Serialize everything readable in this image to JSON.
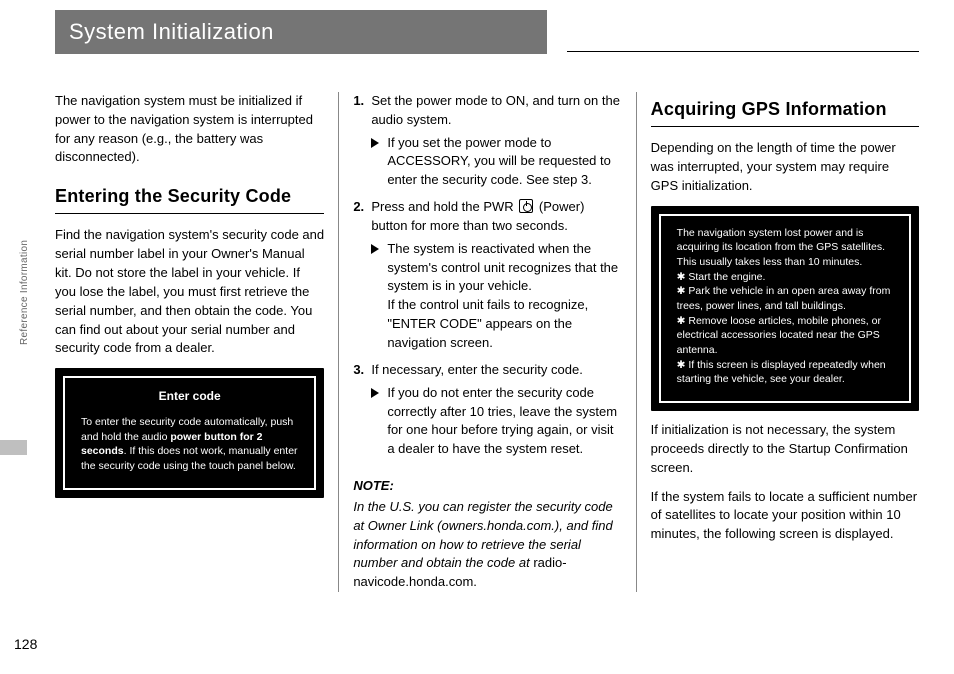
{
  "header": {
    "title": "System Initialization"
  },
  "side": {
    "tab": "Reference Information",
    "page_number": "128"
  },
  "col1": {
    "intro": "The navigation system must be initialized if power to the navigation system is interrupted for any reason (e.g., the battery was disconnected).",
    "section_title": "Entering the Security Code",
    "para": "Find the navigation system's security code and serial number label in your Owner's Manual kit. Do not store the label in your vehicle. If you lose the label, you must first retrieve the serial number, and then obtain the code. You can find out about your serial number and security code from a dealer.",
    "screen_title": "Enter code",
    "screen_body_1": "To enter the security code automatically, push and hold the audio ",
    "screen_body_bold": "power button for 2 seconds",
    "screen_body_2": ". If this does not work, manually enter the security code using the touch panel below."
  },
  "col2": {
    "steps": [
      {
        "text": "Set the power mode to ON, and turn on the audio system.",
        "sub": "If you set the power mode to ACCESSORY, you will be requested to enter the security code. See step 3."
      },
      {
        "text_a": "Press and hold the PWR ",
        "text_b": " (Power) button for more than two seconds.",
        "sub": "The system is reactivated when the system's control unit recognizes that the system is in your vehicle.\nIf the control unit fails to recognize, \"ENTER CODE\" appears on the navigation screen."
      },
      {
        "text": "If necessary, enter the security code.",
        "sub": "If you do not enter the security code correctly after 10 tries, leave the system for one hour before trying again, or visit a dealer to have the system reset."
      }
    ],
    "note_label": "NOTE:",
    "note_body_italic": "In the U.S. you can register the security code at Owner Link (owners.honda.com.), and find information on how to retrieve the serial number and obtain the code at",
    "note_body_roman": "radio-navicode.honda.com."
  },
  "col3": {
    "section_title": "Acquiring GPS Information",
    "para1": "Depending on the length of time the power was interrupted, your system may require GPS initialization.",
    "screen_lines": [
      "The navigation system lost power and is acquiring its location from the GPS satellites. This usually takes less than 10 minutes.",
      "✱ Start the engine.",
      "✱ Park the vehicle in an open area away from trees, power lines, and tall buildings.",
      "✱ Remove loose articles, mobile phones, or electrical accessories located near the GPS antenna.",
      "✱ If this screen is displayed repeatedly when starting the vehicle, see your dealer."
    ],
    "para2": "If initialization is not necessary, the system proceeds directly to the Startup Confirmation screen.",
    "para3": "If the system fails to locate a sufficient number of satellites to locate your position within 10 minutes, the following screen is displayed."
  }
}
